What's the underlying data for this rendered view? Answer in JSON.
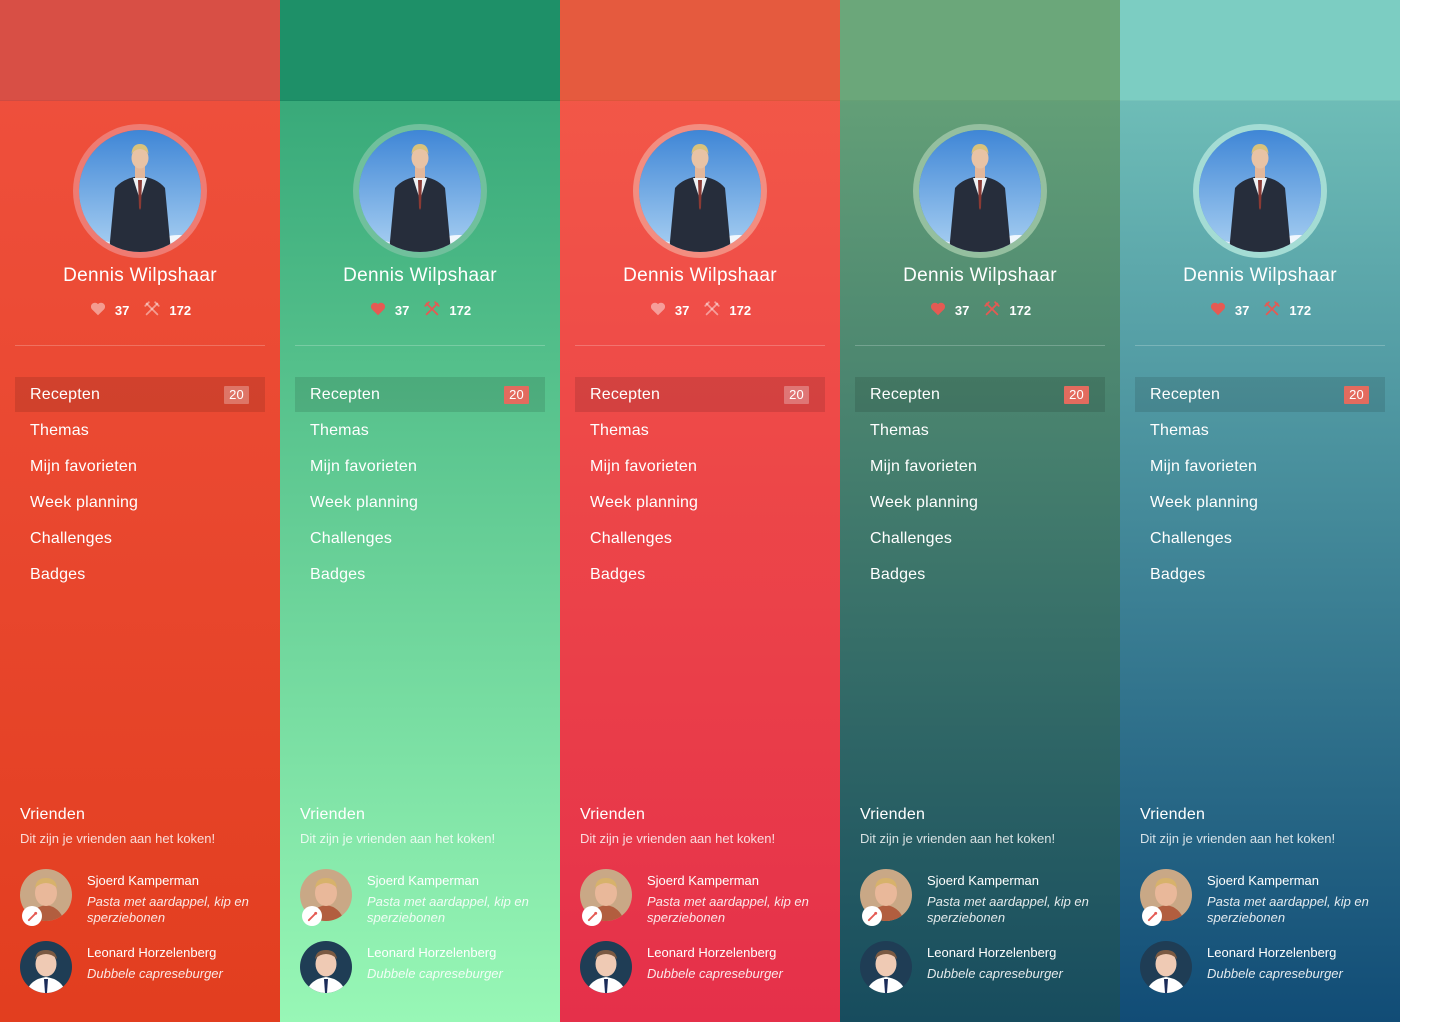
{
  "panels": [
    {
      "gradient": [
        "#f0513f",
        "#e23e1f"
      ],
      "topbar_tint": "#d84f45",
      "ring": "#ef7b72",
      "badge_bg": "rgba(255,255,255,0.28)",
      "heart_color": "rgba(255,255,255,0.45)",
      "scissors_color": "rgba(255,255,255,0.45)"
    },
    {
      "gradient": [
        "#2ea173",
        "#98f7b6"
      ],
      "topbar_tint": "#1e9068",
      "ring": "#70c09c",
      "badge_bg": "#e36b5e",
      "heart_color": "#e55a53",
      "scissors_color": "#e55a53"
    },
    {
      "gradient": [
        "#f45b47",
        "#e5304a"
      ],
      "topbar_tint": "#e55a3e",
      "ring": "#f38d80",
      "badge_bg": "rgba(255,255,255,0.28)",
      "heart_color": "rgba(255,255,255,0.45)",
      "scissors_color": "rgba(255,255,255,0.45)"
    },
    {
      "gradient": [
        "#6ba87a",
        "#174c5e"
      ],
      "topbar_tint": "#6ba77a",
      "ring": "#94bf9f",
      "badge_bg": "#e36b5e",
      "heart_color": "#e55a53",
      "scissors_color": "#e55a53"
    },
    {
      "gradient": [
        "#78c9be",
        "#114c76"
      ],
      "topbar_tint": "#7ccdc2",
      "ring": "#a4dcd4",
      "badge_bg": "#e36b5e",
      "heart_color": "#e55a53",
      "scissors_color": "#e55a53"
    }
  ],
  "profile": {
    "name": "Dennis Wilpshaar",
    "likes": "37",
    "recipes": "172",
    "avatar_icon": "man-in-suit-photo",
    "like_icon": "heart-icon",
    "recipes_icon": "fork-knife-icon"
  },
  "menu": [
    {
      "label": "Recepten",
      "count": "20",
      "active": true
    },
    {
      "label": "Themas"
    },
    {
      "label": "Mijn favorieten"
    },
    {
      "label": "Week planning"
    },
    {
      "label": "Challenges"
    },
    {
      "label": "Badges"
    }
  ],
  "friends": {
    "title": "Vrienden",
    "subtitle": "Dit zijn je vrienden aan het koken!",
    "list": [
      {
        "name": "Sjoerd Kamperman",
        "activity": "Pasta met aardappel, kip en sperziebonen",
        "cooking_badge": "cooking-badge-icon"
      },
      {
        "name": "Leonard Horzelenberg",
        "activity": "Dubbele capreseburger"
      }
    ]
  }
}
